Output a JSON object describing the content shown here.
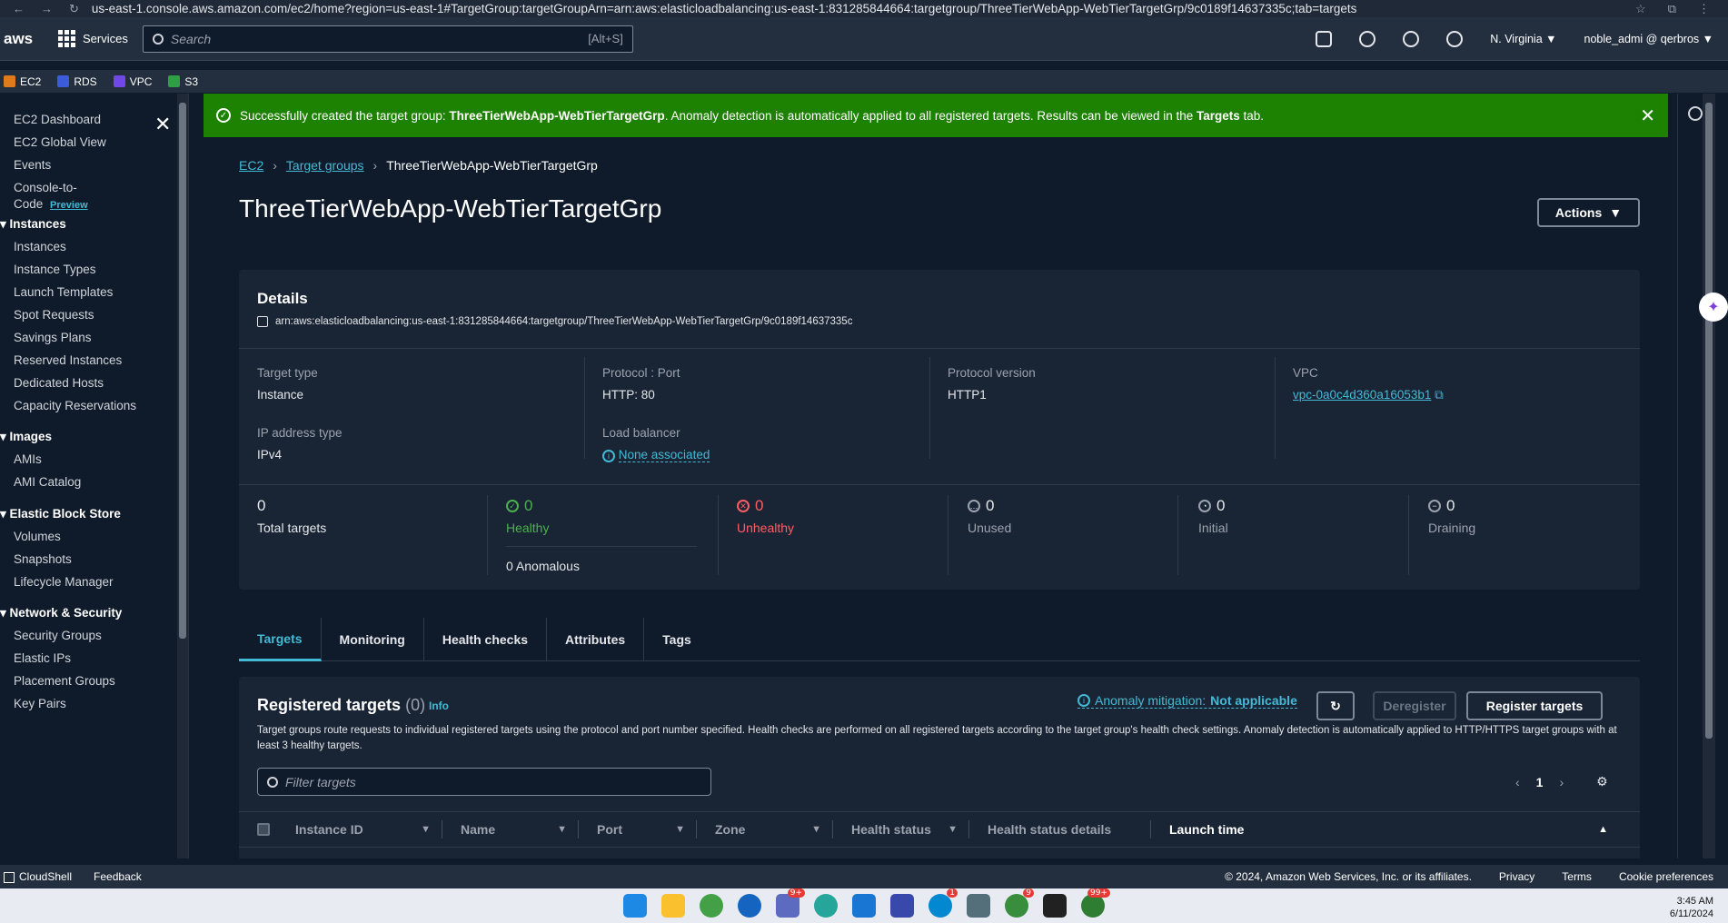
{
  "browser": {
    "url": "us-east-1.console.aws.amazon.com/ec2/home?region=us-east-1#TargetGroup:targetGroupArn=arn:aws:elasticloadbalancing:us-east-1:831285844664:targetgroup/ThreeTierWebApp-WebTierTargetGrp/9c0189f14637335c;tab=targets"
  },
  "topnav": {
    "logo": "aws",
    "services": "Services",
    "search_placeholder": "Search",
    "search_shortcut": "[Alt+S]",
    "region": "N. Virginia ▼",
    "user": "noble_admi @ qerbros ▼"
  },
  "favorites": [
    {
      "label": "EC2",
      "color": "#e07b1d"
    },
    {
      "label": "RDS",
      "color": "#3b5bdb"
    },
    {
      "label": "VPC",
      "color": "#7048e8"
    },
    {
      "label": "S3",
      "color": "#2f9e44"
    }
  ],
  "sidebar": {
    "items": [
      "EC2 Dashboard",
      "EC2 Global View",
      "Events"
    ],
    "console_to_code": "Console-to-",
    "console_to_code_2": "Code",
    "preview": "Preview",
    "sections": [
      {
        "title": "Instances",
        "items": [
          "Instances",
          "Instance Types",
          "Launch Templates",
          "Spot Requests",
          "Savings Plans",
          "Reserved Instances",
          "Dedicated Hosts",
          "Capacity Reservations"
        ]
      },
      {
        "title": "Images",
        "items": [
          "AMIs",
          "AMI Catalog"
        ]
      },
      {
        "title": "Elastic Block Store",
        "items": [
          "Volumes",
          "Snapshots",
          "Lifecycle Manager"
        ]
      },
      {
        "title": "Network & Security",
        "items": [
          "Security Groups",
          "Elastic IPs",
          "Placement Groups",
          "Key Pairs"
        ]
      }
    ]
  },
  "banner": {
    "prefix": "Successfully created the target group: ",
    "name": "ThreeTierWebApp-WebTierTargetGrp",
    "middle": ". Anomaly detection is automatically applied to all registered targets. Results can be viewed in the ",
    "tab": "Targets",
    "suffix": " tab."
  },
  "breadcrumb": {
    "root": "EC2",
    "parent": "Target groups",
    "current": "ThreeTierWebApp-WebTierTargetGrp"
  },
  "page_title": "ThreeTierWebApp-WebTierTargetGrp",
  "actions_label": "Actions",
  "details": {
    "heading": "Details",
    "arn": "arn:aws:elasticloadbalancing:us-east-1:831285844664:targetgroup/ThreeTierWebApp-WebTierTargetGrp/9c0189f14637335c",
    "target_type_label": "Target type",
    "target_type": "Instance",
    "protocol_port_label": "Protocol : Port",
    "protocol_port": "HTTP: 80",
    "protocol_version_label": "Protocol version",
    "protocol_version": "HTTP1",
    "vpc_label": "VPC",
    "vpc": "vpc-0a0c4d360a16053b1",
    "ip_type_label": "IP address type",
    "ip_type": "IPv4",
    "lb_label": "Load balancer",
    "lb": "None associated"
  },
  "stats": {
    "total": "0",
    "total_label": "Total targets",
    "healthy": "0",
    "healthy_label": "Healthy",
    "anomalous": "0 Anomalous",
    "unhealthy": "0",
    "unhealthy_label": "Unhealthy",
    "unused": "0",
    "unused_label": "Unused",
    "initial": "0",
    "initial_label": "Initial",
    "draining": "0",
    "draining_label": "Draining"
  },
  "tabs": [
    "Targets",
    "Monitoring",
    "Health checks",
    "Attributes",
    "Tags"
  ],
  "registered": {
    "title": "Registered targets",
    "count": "(0)",
    "info": "Info",
    "anomaly_label": "Anomaly mitigation:",
    "anomaly_value": "Not applicable",
    "deregister": "Deregister",
    "register": "Register targets",
    "description": "Target groups route requests to individual registered targets using the protocol and port number specified. Health checks are performed on all registered targets according to the target group's health check settings. Anomaly detection is automatically applied to HTTP/HTTPS target groups with at least 3 healthy targets.",
    "filter_placeholder": "Filter targets",
    "page": "1",
    "columns": [
      "Instance ID",
      "Name",
      "Port",
      "Zone",
      "Health status",
      "Health status details",
      "Launch time"
    ]
  },
  "footer": {
    "cloudshell": "CloudShell",
    "feedback": "Feedback",
    "copyright": "© 2024, Amazon Web Services, Inc. or its affiliates.",
    "privacy": "Privacy",
    "terms": "Terms",
    "cookies": "Cookie preferences"
  },
  "clock": {
    "time": "3:45 AM",
    "date": "6/11/2024"
  }
}
